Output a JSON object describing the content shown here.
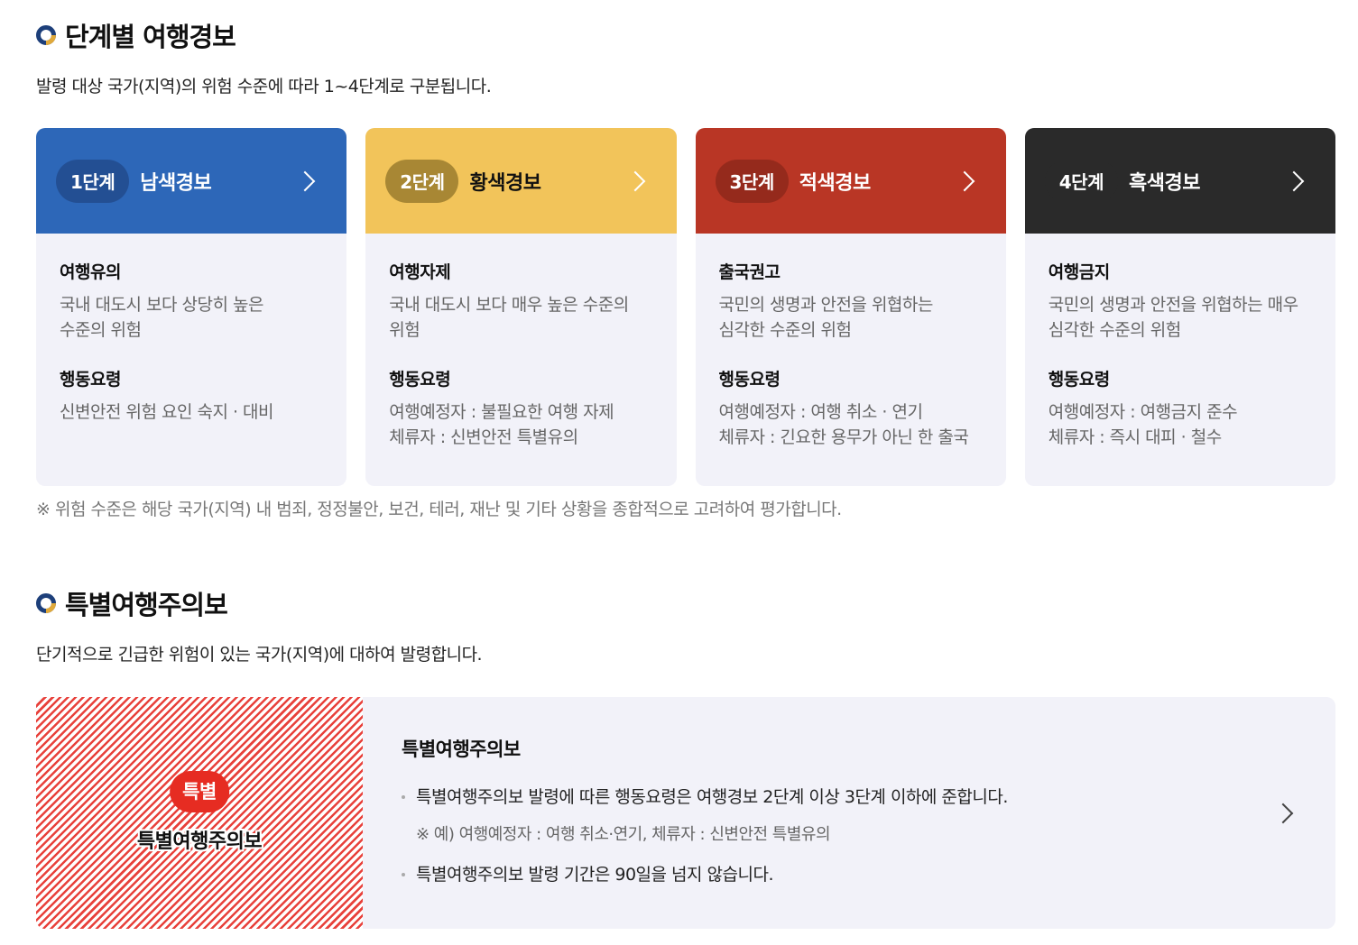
{
  "section1": {
    "title": "단계별 여행경보",
    "description": "발령 대상 국가(지역)의 위험 수준에 따라 1~4단계로 구분됩니다."
  },
  "levels": [
    {
      "stage": "1단계",
      "name": "남색경보",
      "color": "#2d67b8",
      "label1": "여행유의",
      "text1": "국내 대도시 보다 상당히 높은\n수준의 위험",
      "label2": "행동요령",
      "text2": "신변안전 위험 요인 숙지 · 대비"
    },
    {
      "stage": "2단계",
      "name": "황색경보",
      "color": "#f2c45a",
      "label1": "여행자제",
      "text1": "국내 대도시 보다 매우 높은 수준의\n위험",
      "label2": "행동요령",
      "text2": "여행예정자 : 불필요한 여행 자제\n체류자 : 신변안전 특별유의"
    },
    {
      "stage": "3단계",
      "name": "적색경보",
      "color": "#b93625",
      "label1": "출국권고",
      "text1": "국민의 생명과 안전을 위협하는\n심각한 수준의 위험",
      "label2": "행동요령",
      "text2": "여행예정자 : 여행 취소 · 연기\n체류자 : 긴요한 용무가 아닌 한 출국"
    },
    {
      "stage": "4단계",
      "name": "흑색경보",
      "color": "#2a2a2a",
      "label1": "여행금지",
      "text1": "국민의 생명과 안전을 위협하는 매우\n심각한 수준의 위험",
      "label2": "행동요령",
      "text2": "여행예정자 : 여행금지 준수\n체류자 : 즉시 대피 · 철수"
    }
  ],
  "note": "※ 위험 수준은 해당 국가(지역) 내 범죄, 정정불안, 보건, 테러, 재난 및 기타 상황을 종합적으로 고려하여 평가합니다.",
  "section2": {
    "title": "특별여행주의보",
    "description": "단기적으로 긴급한 위험이 있는 국가(지역)에 대하여 발령합니다."
  },
  "special": {
    "badge": "특별",
    "label": "특별여행주의보",
    "heading": "특별여행주의보",
    "bullet1": "특별여행주의보 발령에 따른 행동요령은 여행경보 2단계 이상 3단계 이하에 준합니다.",
    "sub": "※ 예) 여행예정자 : 여행 취소·연기, 체류자 : 신변안전 특별유의",
    "bullet2": "특별여행주의보 발령 기간은 90일을 넘지 않습니다.",
    "stripe_color": "#e8413b"
  },
  "icons": {
    "section_bullet": "ring-bullet-icon",
    "card_arrow": "chevron-right-icon"
  }
}
